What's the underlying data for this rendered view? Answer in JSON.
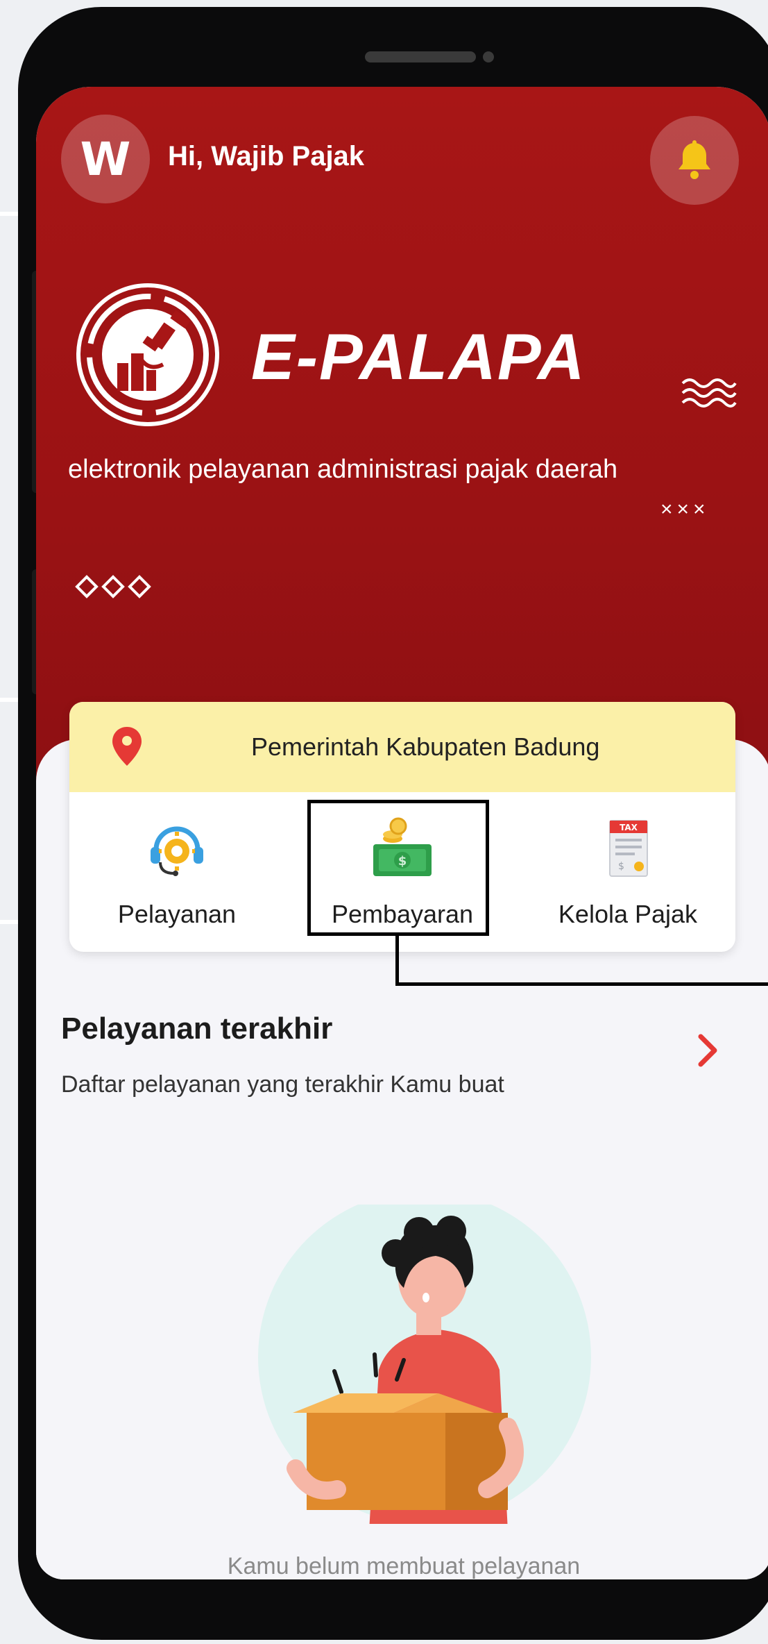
{
  "header": {
    "avatar_initial": "W",
    "greeting": "Hi, Wajib Pajak"
  },
  "brand": {
    "name": "E-PALAPA",
    "tagline": "elektronik pelayanan administrasi pajak daerah",
    "decor_marks": "×××"
  },
  "card": {
    "region": "Pemerintah Kabupaten Badung",
    "menu": [
      {
        "label": "Pelayanan",
        "icon": "customer-service-icon"
      },
      {
        "label": "Pembayaran",
        "icon": "money-payment-icon"
      },
      {
        "label": "Kelola Pajak",
        "icon": "tax-document-icon"
      }
    ],
    "tax_badge": "TAX"
  },
  "recent": {
    "title": "Pelayanan terakhir",
    "subtitle": "Daftar pelayanan yang terakhir Kamu buat",
    "empty_message": "Kamu belum membuat pelayanan"
  },
  "colors": {
    "primary": "#a81616",
    "card_header": "#fbf0a8",
    "accent_red": "#e53935",
    "bell": "#f5c518"
  }
}
